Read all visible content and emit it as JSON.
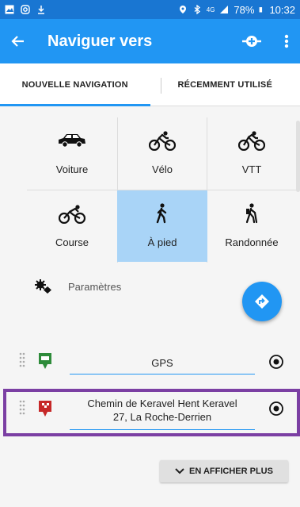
{
  "status_bar": {
    "left_icons": [
      "image-icon",
      "instagram-icon",
      "download-icon"
    ],
    "right_icons": [
      "location-icon",
      "bluetooth-icon",
      "signal-icon"
    ],
    "network": "4G",
    "battery": "78%",
    "time": "10:32"
  },
  "appbar": {
    "title": "Naviguer vers",
    "accent": "#2196f3"
  },
  "tabs": [
    {
      "label": "NOUVELLE NAVIGATION",
      "active": true
    },
    {
      "label": "RÉCEMMENT UTILISÉ",
      "active": false
    }
  ],
  "modes": [
    {
      "label": "Voiture",
      "icon": "car-icon",
      "selected": false
    },
    {
      "label": "Vélo",
      "icon": "bike-icon",
      "selected": false
    },
    {
      "label": "VTT",
      "icon": "mountain-bike-icon",
      "selected": false
    },
    {
      "label": "Course",
      "icon": "race-bike-icon",
      "selected": false
    },
    {
      "label": "À pied",
      "icon": "walk-icon",
      "selected": true
    },
    {
      "label": "Randonnée",
      "icon": "hiking-icon",
      "selected": false
    }
  ],
  "params": {
    "label": "Paramètres"
  },
  "route": {
    "start": {
      "value": "GPS",
      "icon": "start-flag-icon"
    },
    "destination": {
      "value_line1": "Chemin de Keravel Hent Keravel",
      "value_line2": "27, La Roche-Derrien",
      "icon": "finish-flag-icon"
    }
  },
  "more_button": {
    "label": "EN AFFICHER PLUS"
  }
}
